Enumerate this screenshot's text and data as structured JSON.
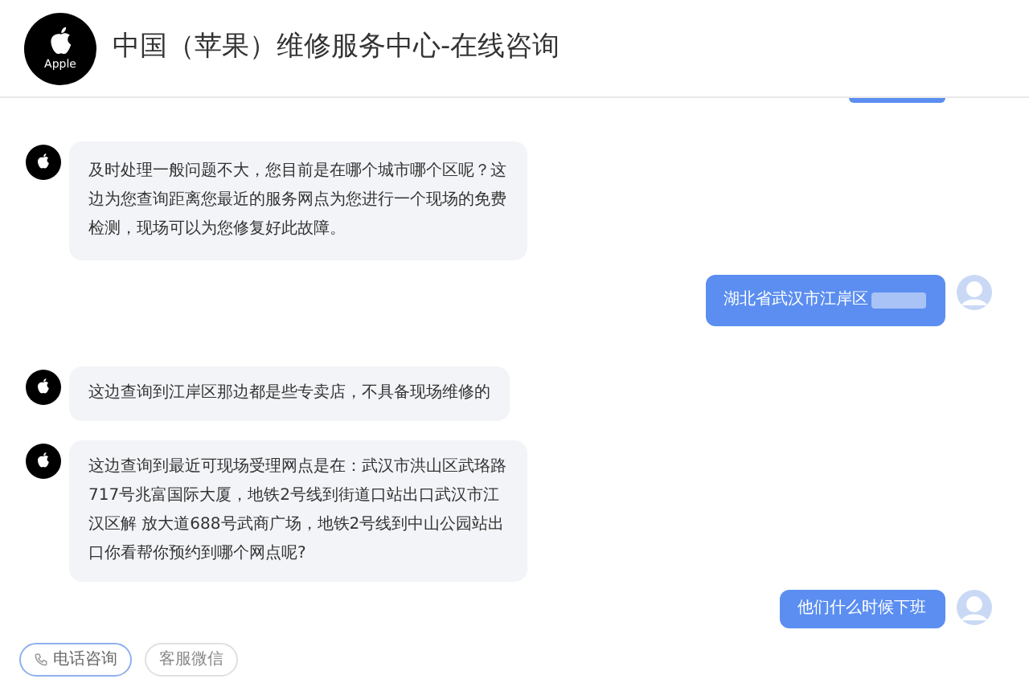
{
  "header": {
    "logo_text": "Apple",
    "title": "中国（苹果）维修服务中心-在线咨询"
  },
  "messages": [
    {
      "kind": "bot",
      "text": "及时处理一般问题不大，您目前是在哪个城市哪个区呢？这边为您查询距离您最近的服务网点为您进行一个现场的免费检测，现场可以为您修复好此故障。"
    },
    {
      "kind": "user",
      "text": "湖北省武汉市江岸区",
      "redacted": true
    },
    {
      "kind": "bot",
      "text": "这边查询到江岸区那边都是些专卖店，不具备现场维修的"
    },
    {
      "kind": "bot",
      "text": "这边查询到最近可现场受理网点是在：武汉市洪山区武珞路717号兆富国际大厦，地铁2号线到街道口站出口武汉市江汉区解 放大道688号武商广场，地铁2号线到中山公园站出口你看帮你预约到哪个网点呢?"
    },
    {
      "kind": "user",
      "text": "他们什么时候下班",
      "redacted": false
    }
  ],
  "quick_actions": [
    {
      "label": "电话咨询",
      "selected": true,
      "kind": "phone"
    },
    {
      "label": "客服微信",
      "selected": false,
      "kind": "plain"
    }
  ]
}
